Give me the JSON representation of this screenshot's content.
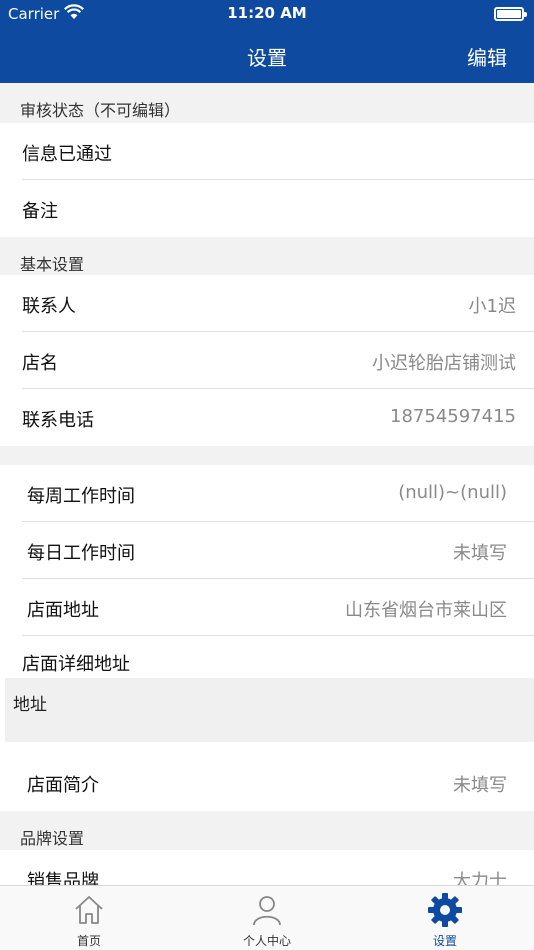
{
  "status": {
    "carrier": "Carrier",
    "time": "11:20 AM"
  },
  "nav": {
    "title": "设置",
    "edit": "编辑"
  },
  "sections": {
    "review": "审核状态（不可编辑）",
    "basic": "基本设置",
    "brand": "品牌设置"
  },
  "review_rows": [
    {
      "label": "信息已通过",
      "value": ""
    },
    {
      "label": "备注",
      "value": ""
    }
  ],
  "basic_rows": [
    {
      "label": "联系人",
      "value": "小1迟"
    },
    {
      "label": "店名",
      "value": "小迟轮胎店铺测试"
    },
    {
      "label": "联系电话",
      "value": "18754597415"
    }
  ],
  "work_rows": [
    {
      "label": "每周工作时间",
      "value": "(null)~(null)"
    },
    {
      "label": "每日工作时间",
      "value": "未填写"
    },
    {
      "label": "店面地址",
      "value": "山东省烟台市莱山区"
    }
  ],
  "address": {
    "title": "店面详细地址",
    "content": "地址"
  },
  "intro_row": {
    "label": "店面简介",
    "value": "未填写"
  },
  "brand_row": {
    "label": "销售品牌",
    "value": "大力士"
  },
  "tabs": [
    {
      "label": "首页",
      "icon": "home-icon"
    },
    {
      "label": "个人中心",
      "icon": "person-icon"
    },
    {
      "label": "设置",
      "icon": "gear-icon"
    }
  ],
  "colors": {
    "primary": "#0d4aa0",
    "background": "#f2f2f2"
  }
}
